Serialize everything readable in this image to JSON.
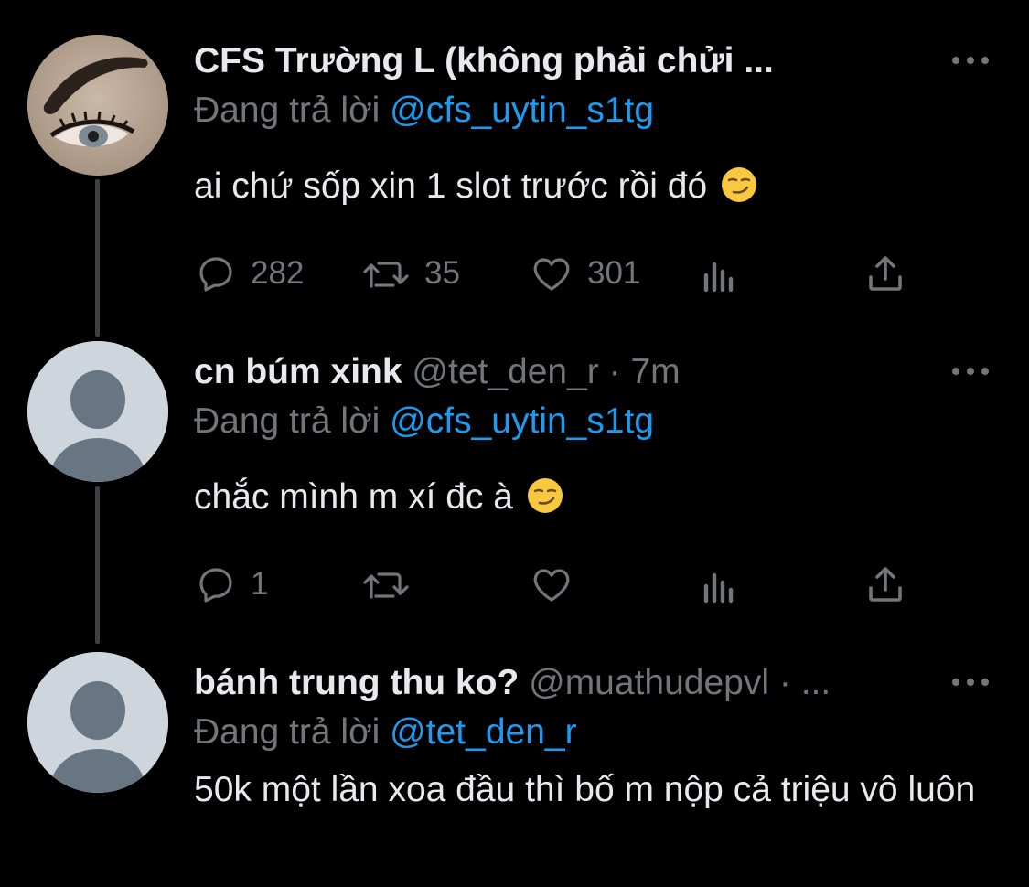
{
  "thread": [
    {
      "display_name": "CFS Trường L (không phải chửi ...",
      "handle": "",
      "time": "",
      "reply_label": "Đang trả lời",
      "reply_to": "@cfs_uytin_s1tg",
      "text": "ai chứ sốp xin 1 slot trước rồi đó",
      "emoji": "smirking-face",
      "stats": {
        "replies": "282",
        "retweets": "35",
        "likes": "301"
      },
      "avatar": "eye-photo"
    },
    {
      "display_name": "cn búm xink",
      "handle": "@tet_den_r",
      "separator": "·",
      "time": "7m",
      "reply_label": "Đang trả lời",
      "reply_to": "@cfs_uytin_s1tg",
      "text": "chắc mình m xí đc à",
      "emoji": "smirking-face",
      "stats": {
        "replies": "1",
        "retweets": "",
        "likes": ""
      },
      "avatar": "default-avatar"
    },
    {
      "display_name": "bánh trung thu ko?",
      "handle": "@muathudepvl",
      "separator": "·",
      "time": "...",
      "reply_label": "Đang trả lời",
      "reply_to": "@tet_den_r",
      "text": "50k một lần xoa đầu thì bố m nộp cả triệu vô luôn",
      "avatar": "default-avatar"
    }
  ],
  "colors": {
    "background": "#000000",
    "text_primary": "#e7e9ea",
    "text_secondary": "#71767b",
    "link": "#1d9bf0",
    "thread_line": "#3e4144",
    "default_avatar_bg": "#ced5dc",
    "default_avatar_fg": "#687684"
  },
  "icons": {
    "reply": "reply-bubble-icon",
    "retweet": "retweet-icon",
    "like": "heart-icon",
    "views": "analytics-icon",
    "share": "share-icon",
    "more": "more-dots-icon"
  }
}
